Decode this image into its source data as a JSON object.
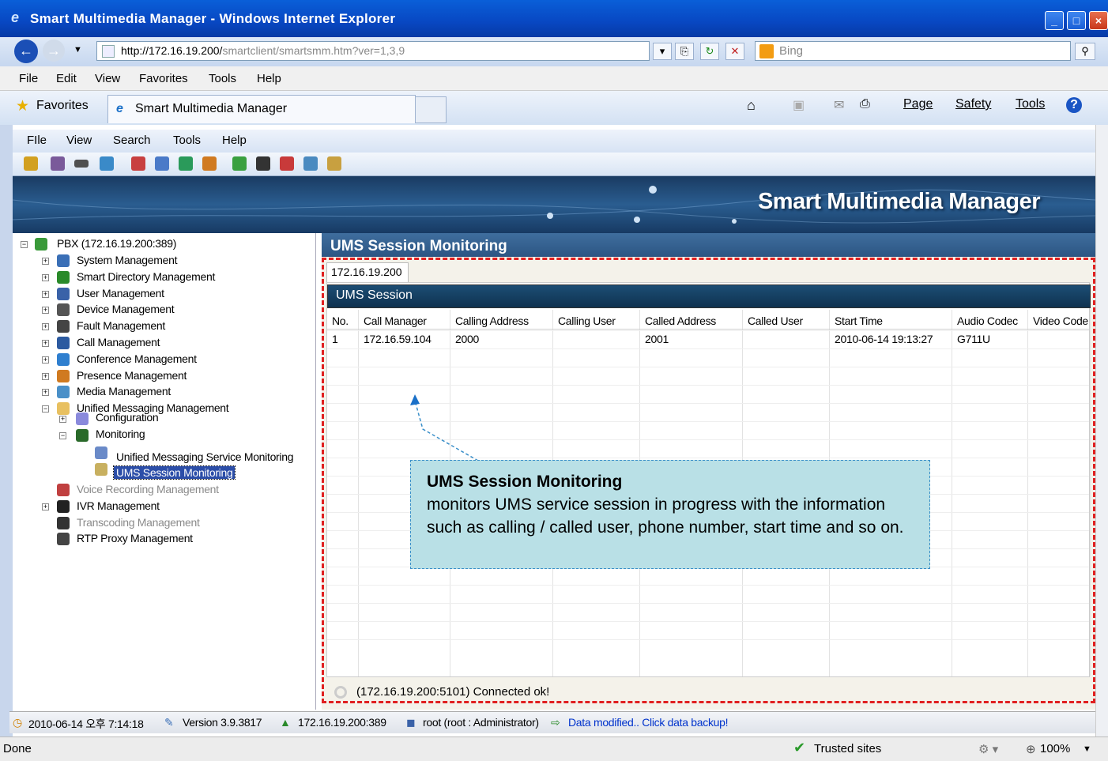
{
  "window": {
    "title": "Smart Multimedia Manager - Windows Internet Explorer"
  },
  "address": {
    "url_host": "http://172.16.19.200/",
    "url_path": "smartclient/smartsmm.htm?ver=1,3,9",
    "search_placeholder": "Bing"
  },
  "ie_menu": [
    "File",
    "Edit",
    "View",
    "Favorites",
    "Tools",
    "Help"
  ],
  "tabs": {
    "favorites": "Favorites",
    "active": "Smart Multimedia Manager"
  },
  "command_bar": [
    "Page",
    "Safety",
    "Tools"
  ],
  "app_menu": [
    "FIle",
    "View",
    "Search",
    "Tools",
    "Help"
  ],
  "banner": {
    "title": "Smart Multimedia Manager"
  },
  "tree": {
    "root": "PBX (172.16.19.200:389)",
    "items": [
      {
        "label": "System Management",
        "icon": "server-icon",
        "color": "#3a6fb6"
      },
      {
        "label": "Smart Directory Management",
        "icon": "triangle-icon",
        "color": "#2a8a2a"
      },
      {
        "label": "User Management",
        "icon": "user-icon",
        "color": "#3a62a8"
      },
      {
        "label": "Device Management",
        "icon": "device-icon",
        "color": "#555555"
      },
      {
        "label": "Fault Management",
        "icon": "fault-icon",
        "color": "#444444"
      },
      {
        "label": "Call Management",
        "icon": "call-icon",
        "color": "#2c5aa0"
      },
      {
        "label": "Conference Management",
        "icon": "conference-icon",
        "color": "#2f7fcf"
      },
      {
        "label": "Presence Management",
        "icon": "presence-icon",
        "color": "#d07a20"
      },
      {
        "label": "Media Management",
        "icon": "media-icon",
        "color": "#4a90c8"
      },
      {
        "label": "Unified Messaging Management",
        "icon": "folder-icon",
        "color": "#e8c060"
      }
    ],
    "ums_children": {
      "configuration": "Configuration",
      "monitoring": "Monitoring",
      "service_monitoring": "Unified Messaging Service Monitoring",
      "session_monitoring": "UMS Session Monitoring"
    },
    "after": [
      {
        "label": "Voice Recording Management",
        "icon": "recording-icon",
        "color": "#c04040",
        "dim": true
      },
      {
        "label": "IVR Management",
        "icon": "ivr-icon",
        "color": "#222222",
        "dim": false
      },
      {
        "label": "Transcoding Management",
        "icon": "transcoding-icon",
        "color": "#333333",
        "dim": true
      },
      {
        "label": "RTP Proxy Management",
        "icon": "proxy-icon",
        "color": "#444444",
        "dim": false
      }
    ]
  },
  "content": {
    "title": "UMS Session Monitoring",
    "ip_tab": "172.16.19.200",
    "grid_title": "UMS Session",
    "columns": [
      "No.",
      "Call Manager",
      "Calling Address",
      "Calling User",
      "Called Address",
      "Called User",
      "Start Time",
      "Audio Codec",
      "Video Code"
    ],
    "rows": [
      [
        "1",
        "172.16.59.104",
        "2000",
        "",
        "2001",
        "",
        "2010-06-14 19:13:27",
        "G711U",
        ""
      ]
    ],
    "status": "(172.16.19.200:5101) Connected ok!"
  },
  "callout": {
    "title": "UMS Session Monitoring",
    "body": "monitors UMS service session in progress with the information such as calling / called user, phone number, start time and so on."
  },
  "statusbar": {
    "datetime": "2010-06-14 오후 7:14:18",
    "version": "Version 3.9.3817",
    "server": "172.16.19.200:389",
    "user": "root (root : Administrator)",
    "backup": "Data modified.. Click data backup!"
  },
  "ie_status": {
    "done": "Done",
    "zone": "Trusted sites",
    "zoom": "100%"
  },
  "colors": {
    "selection": "#2c4ea8",
    "highlight": "#e02020",
    "callout_bg": "#b9e0e6"
  }
}
